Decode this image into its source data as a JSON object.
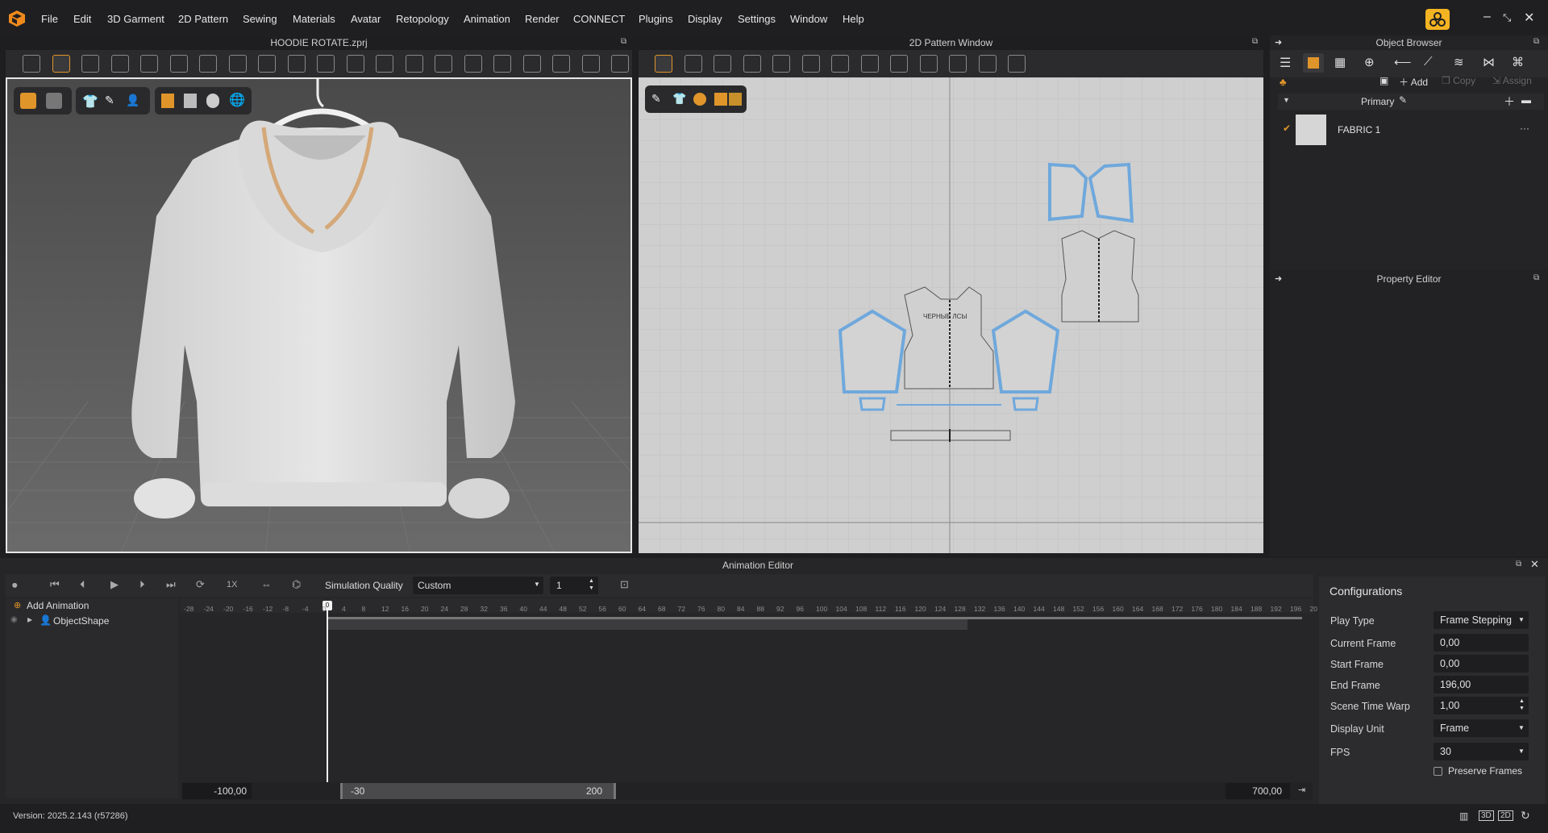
{
  "app": {
    "menus": [
      "File",
      "Edit",
      "3D Garment",
      "2D Pattern",
      "Sewing",
      "Materials",
      "Avatar",
      "Retopology",
      "Animation",
      "Render",
      "CONNECT",
      "Plugins",
      "Display",
      "Settings",
      "Window",
      "Help"
    ],
    "minimize": "–",
    "restore": "⤡",
    "close": "✕"
  },
  "view3d": {
    "title": "HOODIE ROTATE.zprj"
  },
  "view2d": {
    "title": "2D Pattern Window",
    "piece_text": "ЧЕРНЫЕ ЛСЫ"
  },
  "object_browser": {
    "title": "Object Browser",
    "add": "Add",
    "copy": "Copy",
    "assign": "Assign",
    "group": "Primary",
    "fabric": "FABRIC 1",
    "more": "···"
  },
  "property_editor": {
    "title": "Property Editor"
  },
  "animation": {
    "title": "Animation Editor",
    "sim_quality_label": "Simulation Quality",
    "sim_quality_value": "Custom",
    "step_value": "1",
    "speed": "1X",
    "add_animation": "Add Animation",
    "object": "ObjectShape",
    "current_marker": "0",
    "ticks": [
      "-28",
      "-24",
      "-20",
      "-16",
      "-12",
      "-8",
      "-4",
      "0",
      "4",
      "8",
      "12",
      "16",
      "20",
      "24",
      "28",
      "32",
      "36",
      "40",
      "44",
      "48",
      "52",
      "56",
      "60",
      "64",
      "68",
      "72",
      "76",
      "80",
      "84",
      "88",
      "92",
      "96",
      "100",
      "104",
      "108",
      "112",
      "116",
      "120",
      "124",
      "128",
      "132",
      "136",
      "140",
      "144",
      "148",
      "152",
      "156",
      "160",
      "164",
      "168",
      "172",
      "176",
      "180",
      "184",
      "188",
      "192",
      "196",
      "20"
    ],
    "range_left": "-100,00",
    "range_start": "-30",
    "range_end": "200",
    "range_right": "700,00"
  },
  "config": {
    "title": "Configurations",
    "rows": [
      {
        "label": "Play Type",
        "value": "Frame Stepping"
      },
      {
        "label": "Current Frame",
        "value": "0,00"
      },
      {
        "label": "Start Frame",
        "value": "0,00"
      },
      {
        "label": "End Frame",
        "value": "196,00"
      },
      {
        "label": "Scene Time Warp",
        "value": "1,00"
      },
      {
        "label": "Display Unit",
        "value": "Frame"
      },
      {
        "label": "FPS",
        "value": "30"
      }
    ],
    "preserve": "Preserve Frames"
  },
  "status": {
    "version": "Version: 2025.2.143 (r57286)"
  },
  "colors": {
    "accent": "#f4b322",
    "selection": "#6fa8dc",
    "background": "#1e1e20"
  }
}
